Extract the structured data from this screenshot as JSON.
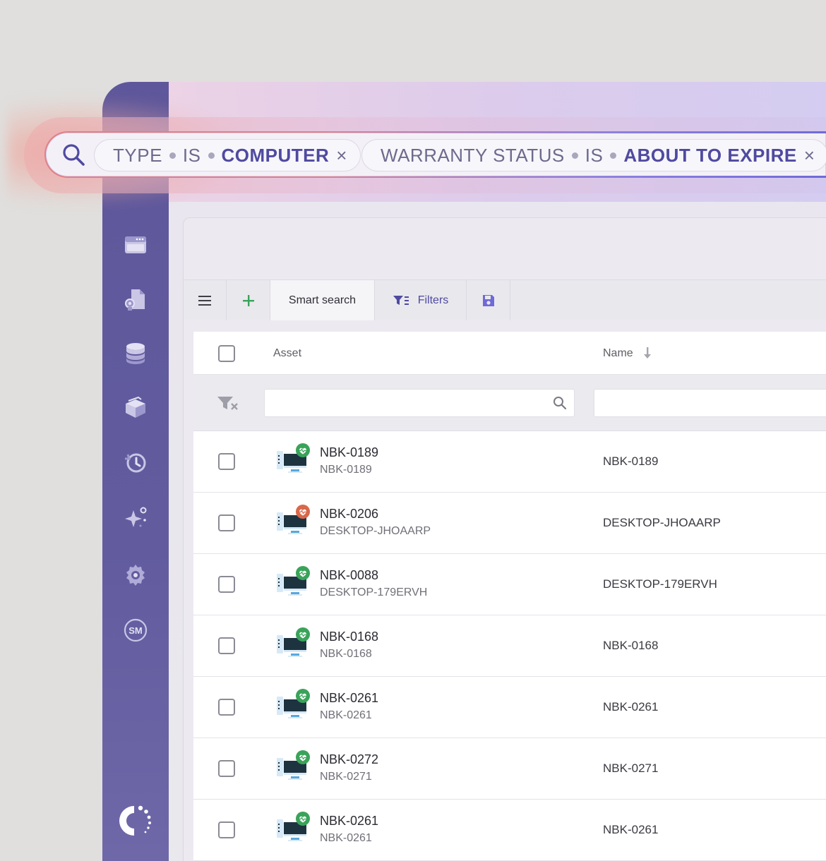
{
  "colors": {
    "sidebar": "#5e579b",
    "accent_purple": "#4f4aa0",
    "accent_green": "#3aa35a",
    "status_good": "#3aa35a",
    "status_warn": "#d9674a",
    "search_border": "#e07f87"
  },
  "search": {
    "icon": "search-icon",
    "chips": [
      {
        "field": "TYPE",
        "op": "IS",
        "value": "COMPUTER",
        "remove": "×"
      },
      {
        "field": "WARRANTY STATUS",
        "op": "IS",
        "value": "ABOUT TO EXPIRE",
        "remove": "×"
      }
    ]
  },
  "sidebar": {
    "items": [
      {
        "icon": "dashboard-icon"
      },
      {
        "icon": "asset-document-icon"
      },
      {
        "icon": "database-icon"
      },
      {
        "icon": "package-icon"
      },
      {
        "icon": "history-icon"
      },
      {
        "icon": "sparkle-ai-icon"
      },
      {
        "icon": "gear-icon"
      },
      {
        "icon": "sm-icon",
        "label": "SM"
      }
    ],
    "logo": "brand-logo-icon"
  },
  "toolbar": {
    "menu_icon": "hamburger-icon",
    "add_icon": "plus-icon",
    "smart_search": "Smart search",
    "filters": "Filters",
    "save_icon": "save-icon"
  },
  "table": {
    "columns": {
      "asset": "Asset",
      "name": "Name"
    },
    "sort_icon": "sort-down-icon",
    "filter_icon": "filter-clear-icon",
    "rows": [
      {
        "title": "NBK-0189",
        "sub": "NBK-0189",
        "name": "NBK-0189",
        "status": "good"
      },
      {
        "title": "NBK-0206",
        "sub": "DESKTOP-JHOAARP",
        "name": "DESKTOP-JHOAARP",
        "status": "warn"
      },
      {
        "title": "NBK-0088",
        "sub": "DESKTOP-179ERVH",
        "name": "DESKTOP-179ERVH",
        "status": "good"
      },
      {
        "title": "NBK-0168",
        "sub": "NBK-0168",
        "name": "NBK-0168",
        "status": "good"
      },
      {
        "title": "NBK-0261",
        "sub": "NBK-0261",
        "name": "NBK-0261",
        "status": "good"
      },
      {
        "title": "NBK-0272",
        "sub": "NBK-0271",
        "name": "NBK-0271",
        "status": "good"
      },
      {
        "title": "NBK-0261",
        "sub": "NBK-0261",
        "name": "NBK-0261",
        "status": "good"
      }
    ]
  }
}
